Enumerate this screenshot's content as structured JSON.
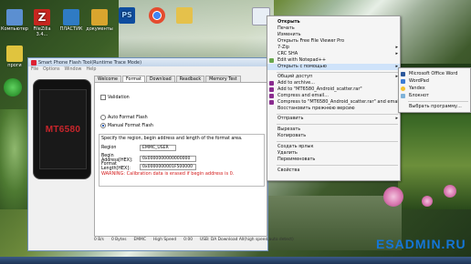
{
  "desktop": {
    "icons": [
      {
        "label": "Компьютер",
        "color": "#5b8fd1"
      },
      {
        "label": "FileZilla 3.4...",
        "color": "#c8261f"
      },
      {
        "label": "ПЛАСТИК",
        "color": "#2f7bc4"
      },
      {
        "label": "документы",
        "color": "#d9a52e"
      },
      {
        "label": "PS",
        "color": "#0e4d9f"
      },
      {
        "label": "Google Chrome",
        "color": "#e44b2f"
      },
      {
        "label": "",
        "color": "#e5c14b"
      }
    ],
    "left_icons": [
      {
        "label": "проги",
        "color": "#e0c43e"
      }
    ]
  },
  "window": {
    "title": "Smart Phone Flash Tool(Runtime Trace Mode)",
    "menu": [
      "File",
      "Options",
      "Window",
      "Help"
    ],
    "phone_label": "MT6580",
    "tabs": [
      "Welcome",
      "Format",
      "Download",
      "Readback",
      "Memory Test"
    ],
    "active_tab": "Format",
    "validation_label": "Validation",
    "auto_format": "Auto Format Flash",
    "manual_format": "Manual Format Flash",
    "region_prompt": "Specify the region, begin address and length of the format area.",
    "region_label": "Region",
    "region_value": "EMMC_USER",
    "begin_label": "Begin Address[HEX]:",
    "begin_value": "0x0000000000000000",
    "length_label": "Format Length[HEX]:",
    "length_value": "0x0000000001F500000",
    "warning": "WARNING: Calibration data is erased if begin address is 0.",
    "status": [
      "0 B/s",
      "0 Bytes",
      "EMMC",
      "High Speed",
      "0:00",
      "USB: DA Download All(high speed,auto detect)"
    ]
  },
  "context_menu": {
    "items": [
      "Открыть",
      "Печать",
      "Изменить",
      "Открыть Free File Viewer Pro",
      "7-Zip",
      "CRC SHA",
      "Edit with Notepad++",
      "Открыть с помощью",
      "",
      "Общий доступ",
      "Add to archive...",
      "Add to \"MT6580_Android_scatter.rar\"",
      "Compress and email...",
      "Compress to \"MT6580_Android_scatter.rar\" and email",
      "Восстановить прежнюю версию",
      "",
      "Отправить",
      "",
      "Вырезать",
      "Копировать",
      "",
      "Создать ярлык",
      "Удалить",
      "Переименовать",
      "",
      "Свойства"
    ],
    "submenu_items": [
      1,
      4,
      5,
      7,
      16
    ]
  },
  "open_with_menu": {
    "items": [
      "Microsoft Office Word",
      "WordPad",
      "Yandex",
      "Блокнот",
      "",
      "Выбрать программу..."
    ]
  },
  "watermark": "ESADMIN.RU"
}
